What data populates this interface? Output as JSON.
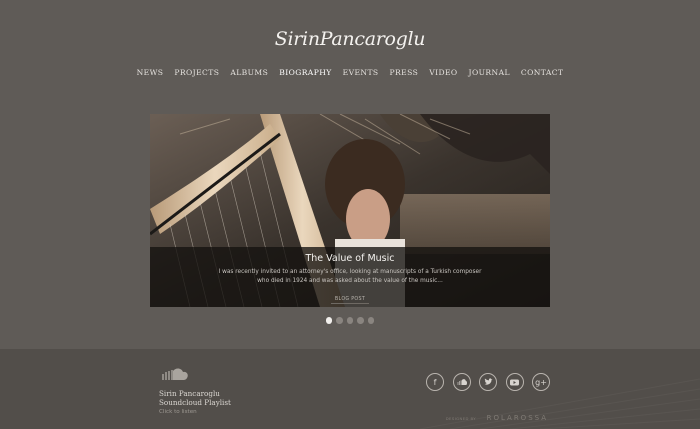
{
  "site": {
    "logo": "SirinPancaroglu"
  },
  "nav": {
    "items": [
      {
        "label": "NEWS"
      },
      {
        "label": "PROJECTS"
      },
      {
        "label": "ALBUMS"
      },
      {
        "label": "BIOGRAPHY"
      },
      {
        "label": "EVENTS"
      },
      {
        "label": "PRESS"
      },
      {
        "label": "VIDEO"
      },
      {
        "label": "JOURNAL"
      },
      {
        "label": "CONTACT"
      }
    ],
    "active": "BIOGRAPHY"
  },
  "hero": {
    "title": "The Value of Music",
    "text": "I was recently invited to an attorney's office, looking at manuscripts of a Turkish composer who died in 1924 and was asked about the value of the music...",
    "button": "BLOG POST"
  },
  "slider": {
    "count": 5,
    "active_index": 0
  },
  "footer": {
    "playlist_line1": "Sirin Pancaroglu",
    "playlist_line2": "Soundcloud Playlist",
    "playlist_link": "Click to listen",
    "social": [
      "facebook-icon",
      "soundcloud-icon",
      "twitter-icon",
      "youtube-icon",
      "google-plus-icon"
    ],
    "credit_prefix": "DESIGNED BY",
    "credit_name": "ROLAROSSA"
  },
  "colors": {
    "background": "#5f5b57",
    "footer": "#524e4a",
    "caption_overlay": "#141210",
    "dot_active": "#f2f0ed",
    "dot_inactive": "#8a8580"
  }
}
